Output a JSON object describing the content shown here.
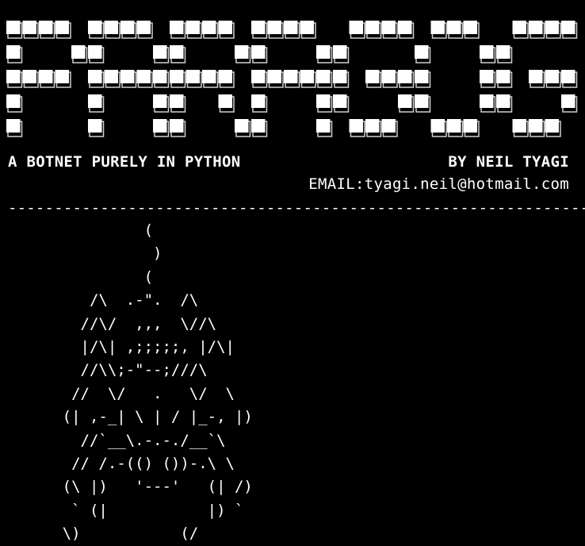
{
  "banner": {
    "letters": [
      "P",
      "A",
      "R",
      "A",
      "G",
      "O",
      "G"
    ],
    "fg": "#ffffff",
    "shadow": "#cfcfcf"
  },
  "header": {
    "tagline": "A BOTNET PURELY IN PYTHON",
    "author": "BY NEIL TYAGI",
    "email": "EMAIL:tyagi.neil@hotmail.com"
  },
  "divider": "----------------------------------------------------------------",
  "ascii_art": [
    "               (",
    "                )",
    "               (",
    "         /\\  .-\".  /\\",
    "        //\\/  ,,,  \\//\\",
    "        |/\\| ,;;;;;, |/\\|",
    "        //\\\\;-\"--;///\\",
    "       //  \\/   .   \\/  \\",
    "      (| ,-_| \\ | / |_-, |)",
    "        //`__\\.-.-./__`\\",
    "       // /.-(() ())-.\\ \\",
    "      (\\ |)   '---'   (| /)",
    "       ` (|           |) `",
    "      \\)           (/"
  ]
}
